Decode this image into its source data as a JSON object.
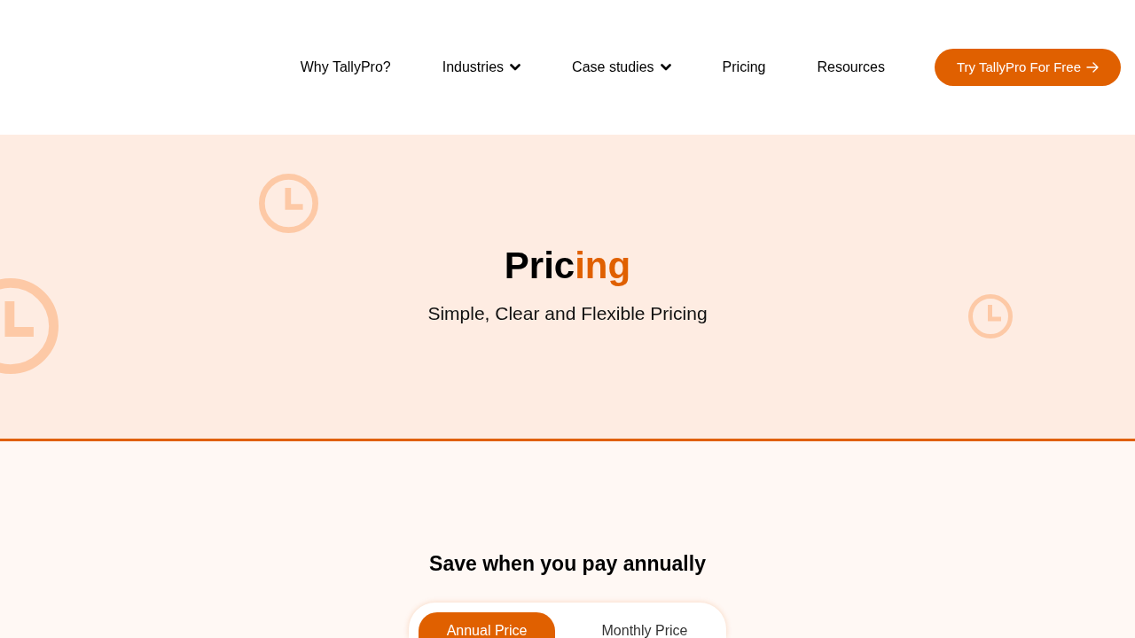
{
  "nav": {
    "items": [
      {
        "label": "Why TallyPro?",
        "has_dropdown": false
      },
      {
        "label": "Industries",
        "has_dropdown": true
      },
      {
        "label": "Case studies",
        "has_dropdown": true
      },
      {
        "label": "Pricing",
        "has_dropdown": false
      },
      {
        "label": "Resources",
        "has_dropdown": false
      }
    ]
  },
  "cta_button": {
    "label": "Try TallyPro For Free"
  },
  "hero": {
    "title": [
      {
        "text": "Pric",
        "accent": false
      },
      {
        "text": "ing",
        "accent": true
      }
    ],
    "subtitle": "Simple, Clear and Flexible Pricing"
  },
  "pricing": {
    "heading": "Save when you pay annually",
    "billing_toggle": [
      {
        "label": "Annual Price",
        "selected": true
      },
      {
        "label": "Monthly Price",
        "selected": false
      }
    ]
  }
}
